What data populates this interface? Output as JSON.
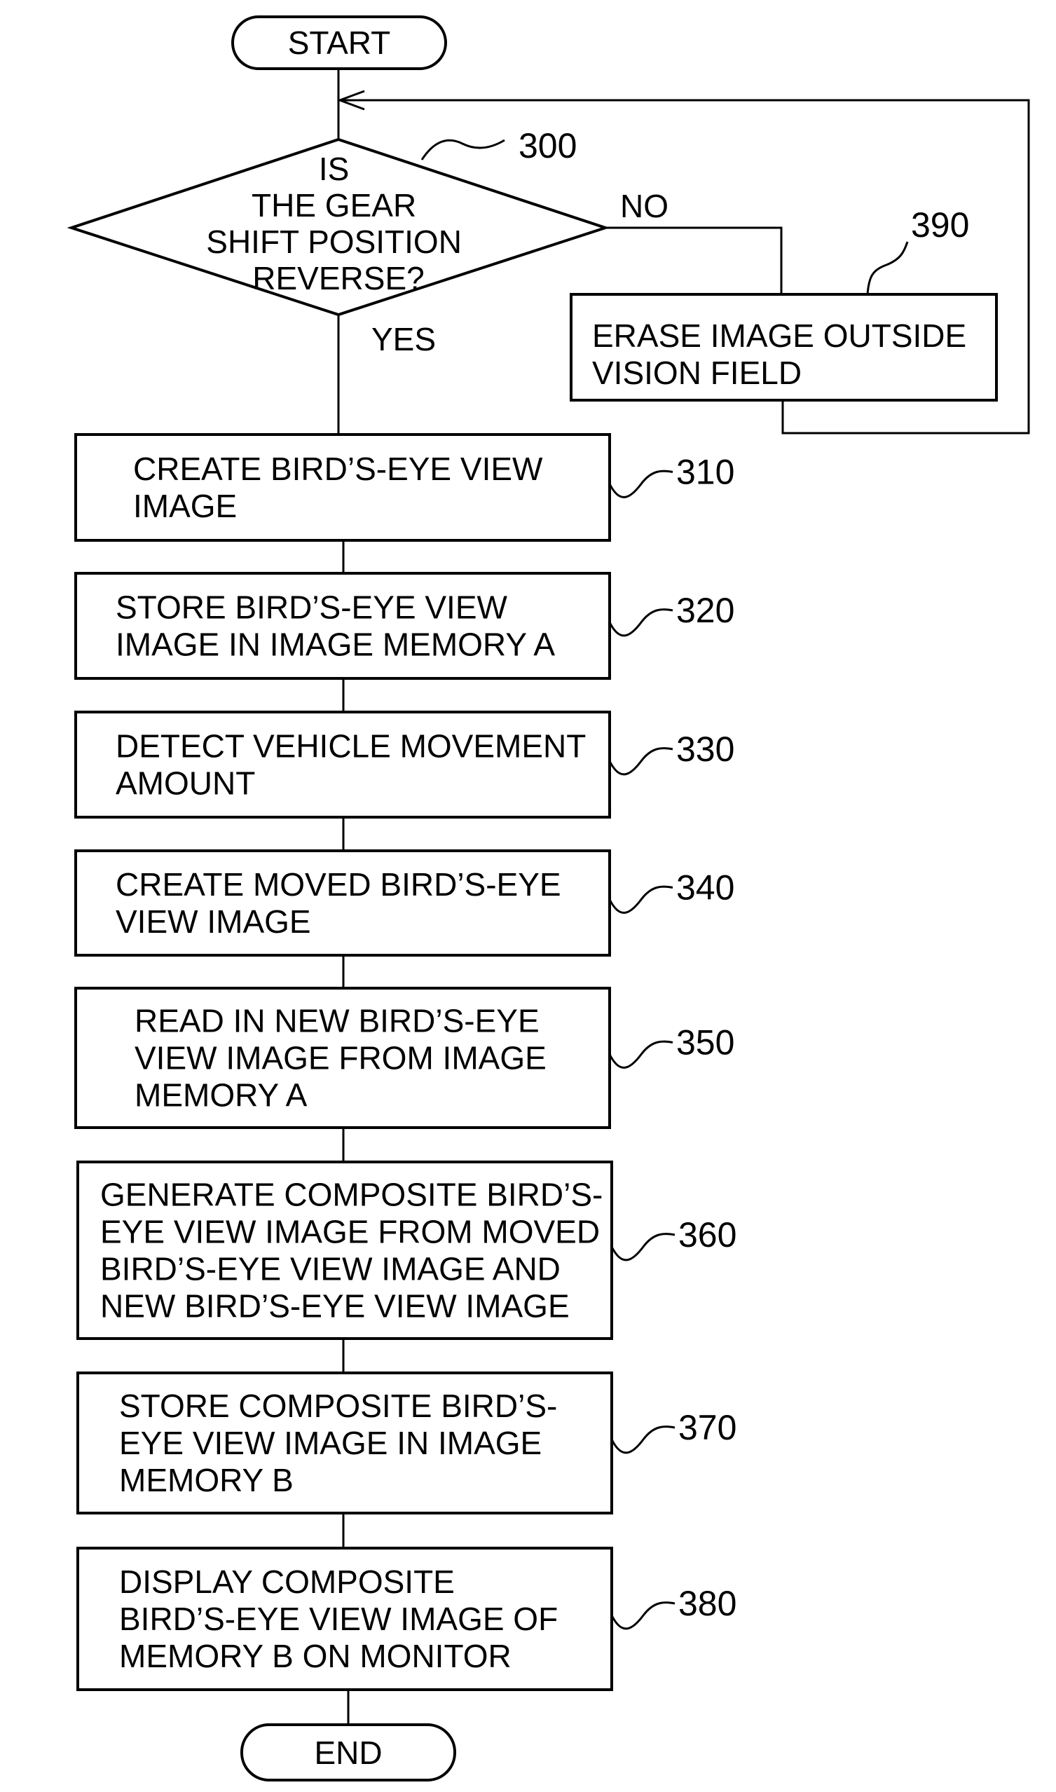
{
  "diagram": {
    "type": "flowchart",
    "terminals": {
      "start": "START",
      "end": "END"
    },
    "decision": {
      "ref": "300",
      "lines": [
        "IS",
        "THE GEAR",
        "SHIFT POSITION",
        "REVERSE?"
      ],
      "yes_label": "YES",
      "no_label": "NO"
    },
    "no_branch_step": {
      "ref": "390",
      "lines": [
        "ERASE IMAGE OUTSIDE",
        "VISION FIELD"
      ]
    },
    "steps": [
      {
        "ref": "310",
        "lines": [
          "CREATE BIRD’S-EYE VIEW",
          "IMAGE"
        ]
      },
      {
        "ref": "320",
        "lines": [
          "STORE BIRD’S-EYE VIEW",
          "IMAGE IN IMAGE MEMORY A"
        ]
      },
      {
        "ref": "330",
        "lines": [
          "DETECT VEHICLE MOVEMENT",
          "AMOUNT"
        ]
      },
      {
        "ref": "340",
        "lines": [
          "CREATE MOVED BIRD’S-EYE",
          "VIEW IMAGE"
        ]
      },
      {
        "ref": "350",
        "lines": [
          "READ IN NEW BIRD’S-EYE",
          "VIEW IMAGE FROM IMAGE",
          "MEMORY A"
        ]
      },
      {
        "ref": "360",
        "lines": [
          "GENERATE COMPOSITE BIRD’S-",
          "EYE VIEW IMAGE FROM MOVED",
          "BIRD’S-EYE VIEW IMAGE AND",
          "NEW BIRD’S-EYE VIEW IMAGE"
        ]
      },
      {
        "ref": "370",
        "lines": [
          "STORE COMPOSITE BIRD’S-",
          "EYE VIEW IMAGE IN IMAGE",
          "MEMORY B"
        ]
      },
      {
        "ref": "380",
        "lines": [
          "DISPLAY COMPOSITE",
          "BIRD’S-EYE VIEW IMAGE OF",
          "MEMORY B ON MONITOR"
        ]
      }
    ]
  }
}
